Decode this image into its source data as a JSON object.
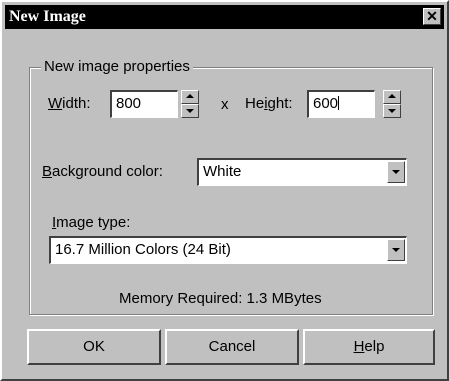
{
  "dialog": {
    "title": "New Image",
    "close_glyph": "✕"
  },
  "properties": {
    "group_label": "New image properties",
    "width_label_prefix": "W",
    "width_label_rest": "idth:",
    "width_value": "800",
    "times_sign": "x",
    "height_label_prefix": "He",
    "height_label_u": "i",
    "height_label_rest": "ght:",
    "height_value": "600",
    "background_label_u": "B",
    "background_label_rest": "ackground color:",
    "background_value": "White",
    "image_type_label_u": "I",
    "image_type_label_rest": "mage type:",
    "image_type_value": "16.7 Million Colors (24 Bit)",
    "memory_text": "Memory Required: 1.3 MBytes"
  },
  "buttons": {
    "ok": "OK",
    "cancel": "Cancel",
    "help_u": "H",
    "help_rest": "elp"
  },
  "icons": {
    "close": "close-icon",
    "spin_up": "arrow-up-icon",
    "spin_down": "arrow-down-icon",
    "dropdown": "chevron-down-icon"
  }
}
